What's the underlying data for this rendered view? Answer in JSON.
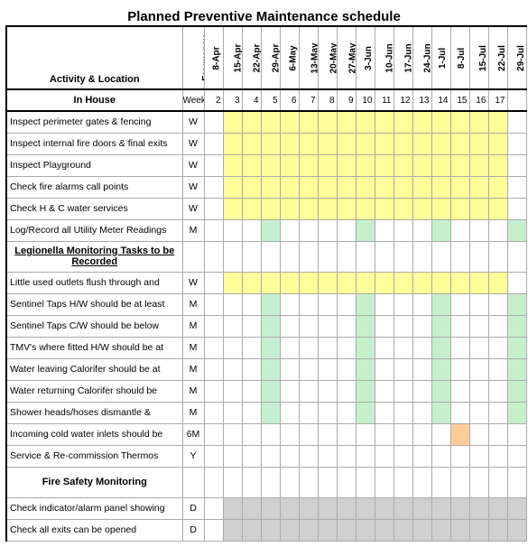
{
  "title": "Planned Preventive Maintenance schedule",
  "headers": {
    "activity": "Activity & Location",
    "frequency": "Frequency",
    "dates": [
      "8-Apr",
      "15-Apr",
      "22-Apr",
      "29-Apr",
      "6-May",
      "13-May",
      "20-May",
      "27-May",
      "3-Jun",
      "10-Jun",
      "17-Jun",
      "24-Jun",
      "1-Jul",
      "8-Jul",
      "15-Jul",
      "22-Jul",
      "29-Jul"
    ]
  },
  "weeknum": {
    "label": "In House",
    "freq": "Week",
    "nums": [
      "2",
      "3",
      "4",
      "5",
      "6",
      "7",
      "8",
      "9",
      "10",
      "11",
      "12",
      "13",
      "14",
      "15",
      "16",
      "17",
      ""
    ]
  },
  "sections": [
    {
      "head": null,
      "rows": [
        {
          "activity": "Inspect perimeter gates & fencing",
          "freq": "W",
          "cells": [
            "",
            "y",
            "y",
            "y",
            "y",
            "y",
            "y",
            "y",
            "y",
            "y",
            "y",
            "y",
            "y",
            "y",
            "y",
            "y",
            ""
          ]
        },
        {
          "activity": "Inspect internal fire doors & final exits",
          "freq": "W",
          "cells": [
            "",
            "y",
            "y",
            "y",
            "y",
            "y",
            "y",
            "y",
            "y",
            "y",
            "y",
            "y",
            "y",
            "y",
            "y",
            "y",
            ""
          ]
        },
        {
          "activity": "Inspect Playground",
          "freq": "W",
          "cells": [
            "",
            "y",
            "y",
            "y",
            "y",
            "y",
            "y",
            "y",
            "y",
            "y",
            "y",
            "y",
            "y",
            "y",
            "y",
            "y",
            ""
          ]
        },
        {
          "activity": "Check fire alarms call points",
          "freq": "W",
          "cells": [
            "",
            "y",
            "y",
            "y",
            "y",
            "y",
            "y",
            "y",
            "y",
            "y",
            "y",
            "y",
            "y",
            "y",
            "y",
            "y",
            ""
          ]
        },
        {
          "activity": "Check H & C water services",
          "freq": "W",
          "cells": [
            "",
            "y",
            "y",
            "y",
            "y",
            "y",
            "y",
            "y",
            "y",
            "y",
            "y",
            "y",
            "y",
            "y",
            "y",
            "y",
            ""
          ]
        },
        {
          "activity": "Log/Record all Utility Meter Readings",
          "freq": "M",
          "cells": [
            "",
            "",
            "",
            "g",
            "",
            "",
            "",
            "",
            "g",
            "",
            "",
            "",
            "g",
            "",
            "",
            "",
            "g"
          ]
        }
      ]
    },
    {
      "head": {
        "text": "Legionella Monitoring Tasks to be Recorded",
        "underline": true
      },
      "rows": [
        {
          "activity": "Little used outlets flush through and",
          "freq": "W",
          "cells": [
            "",
            "y",
            "y",
            "y",
            "y",
            "y",
            "y",
            "y",
            "y",
            "y",
            "y",
            "y",
            "y",
            "y",
            "y",
            "y",
            ""
          ]
        },
        {
          "activity": "Sentinel Taps H/W should be at least",
          "freq": "M",
          "cells": [
            "",
            "",
            "",
            "g",
            "",
            "",
            "",
            "",
            "g",
            "",
            "",
            "",
            "g",
            "",
            "",
            "",
            "g"
          ]
        },
        {
          "activity": "Sentinel Taps C/W should be below",
          "freq": "M",
          "cells": [
            "",
            "",
            "",
            "g",
            "",
            "",
            "",
            "",
            "g",
            "",
            "",
            "",
            "g",
            "",
            "",
            "",
            "g"
          ]
        },
        {
          "activity": "TMV's where fitted H/W should be at",
          "freq": "M",
          "cells": [
            "",
            "",
            "",
            "g",
            "",
            "",
            "",
            "",
            "g",
            "",
            "",
            "",
            "g",
            "",
            "",
            "",
            "g"
          ]
        },
        {
          "activity": "Water leaving Calorifer should be at",
          "freq": "M",
          "cells": [
            "",
            "",
            "",
            "g",
            "",
            "",
            "",
            "",
            "g",
            "",
            "",
            "",
            "g",
            "",
            "",
            "",
            "g"
          ]
        },
        {
          "activity": "Water returning Calorifer should be",
          "freq": "M",
          "cells": [
            "",
            "",
            "",
            "g",
            "",
            "",
            "",
            "",
            "g",
            "",
            "",
            "",
            "g",
            "",
            "",
            "",
            "g"
          ]
        },
        {
          "activity": "Shower heads/hoses dismantle &",
          "freq": "M",
          "cells": [
            "",
            "",
            "",
            "g",
            "",
            "",
            "",
            "",
            "g",
            "",
            "",
            "",
            "g",
            "",
            "",
            "",
            "g"
          ]
        },
        {
          "activity": "Incoming cold water inlets should be",
          "freq": "6M",
          "cells": [
            "",
            "",
            "",
            "",
            "",
            "",
            "",
            "",
            "",
            "",
            "",
            "",
            "",
            "o",
            "",
            "",
            ""
          ]
        },
        {
          "activity": "Service & Re-commission Thermos",
          "freq": "Y",
          "cells": [
            "",
            "",
            "",
            "",
            "",
            "",
            "",
            "",
            "",
            "",
            "",
            "",
            "",
            "",
            "",
            "",
            ""
          ]
        }
      ]
    },
    {
      "head": {
        "text": "Fire Safety Monitoring",
        "underline": false
      },
      "rows": [
        {
          "activity": "Check indicator/alarm panel showing",
          "freq": "D",
          "cells": [
            "",
            "gr",
            "gr",
            "gr",
            "gr",
            "gr",
            "gr",
            "gr",
            "gr",
            "gr",
            "gr",
            "gr",
            "gr",
            "gr",
            "gr",
            "gr",
            "gr"
          ]
        },
        {
          "activity": "Check all exits can be opened",
          "freq": "D",
          "cells": [
            "",
            "gr",
            "gr",
            "gr",
            "gr",
            "gr",
            "gr",
            "gr",
            "gr",
            "gr",
            "gr",
            "gr",
            "gr",
            "gr",
            "gr",
            "gr",
            "gr"
          ]
        }
      ]
    }
  ],
  "colors": {
    "y": "yellow",
    "g": "green",
    "o": "orange",
    "gr": "grey"
  }
}
